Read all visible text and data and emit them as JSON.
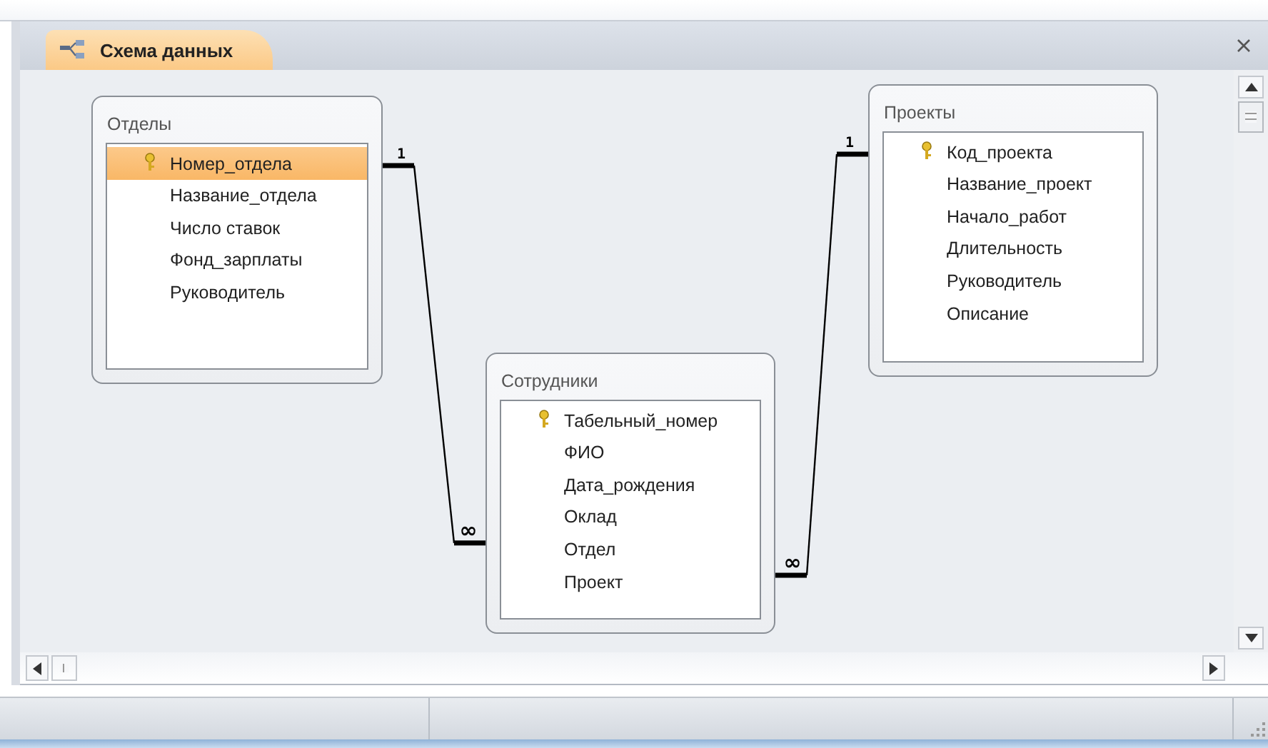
{
  "tab": {
    "title": "Схема данных",
    "selected": true
  },
  "tables": [
    {
      "title": "Отделы",
      "fields": [
        {
          "name": "Номер_отдела",
          "primary_key": true,
          "selected": true
        },
        {
          "name": "Название_отдела",
          "primary_key": false,
          "selected": false
        },
        {
          "name": "Число ставок",
          "primary_key": false,
          "selected": false
        },
        {
          "name": "Фонд_зарплаты",
          "primary_key": false,
          "selected": false
        },
        {
          "name": "Руководитель",
          "primary_key": false,
          "selected": false
        }
      ]
    },
    {
      "title": "Проекты",
      "fields": [
        {
          "name": "Код_проекта",
          "primary_key": true,
          "selected": false
        },
        {
          "name": "Название_проект",
          "primary_key": false,
          "selected": false
        },
        {
          "name": "Начало_работ",
          "primary_key": false,
          "selected": false
        },
        {
          "name": "Длительность",
          "primary_key": false,
          "selected": false
        },
        {
          "name": "Руководитель",
          "primary_key": false,
          "selected": false
        },
        {
          "name": "Описание",
          "primary_key": false,
          "selected": false
        }
      ]
    },
    {
      "title": "Сотрудники",
      "fields": [
        {
          "name": "Табельный_номер",
          "primary_key": true,
          "selected": false
        },
        {
          "name": "ФИО",
          "primary_key": false,
          "selected": false
        },
        {
          "name": "Дата_рождения",
          "primary_key": false,
          "selected": false
        },
        {
          "name": "Оклад",
          "primary_key": false,
          "selected": false
        },
        {
          "name": "Отдел",
          "primary_key": false,
          "selected": false
        },
        {
          "name": "Проект",
          "primary_key": false,
          "selected": false
        }
      ]
    }
  ],
  "relationships": [
    {
      "one_label": "1",
      "many_label": "∞"
    },
    {
      "one_label": "1",
      "many_label": "∞"
    }
  ]
}
